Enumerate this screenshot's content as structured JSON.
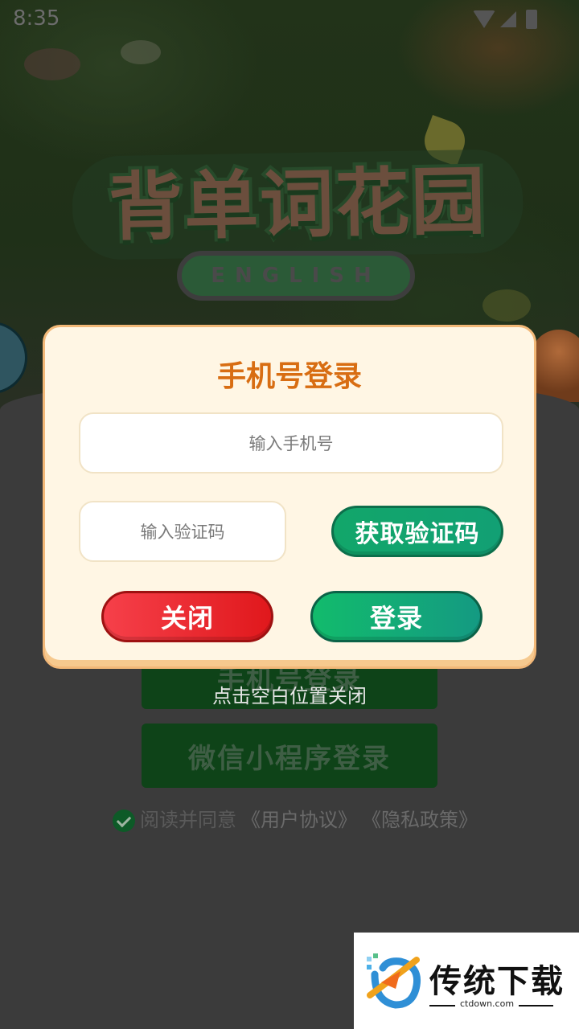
{
  "status_bar": {
    "time": "8:35"
  },
  "app_logo": {
    "title": "背单词花园",
    "subtitle": "ENGLISH"
  },
  "background_page": {
    "phone_login_label": "手机号登录",
    "wechat_login_label": "微信小程序登录",
    "agreement_prefix": "阅读并同意",
    "user_agreement": "《用户协议》",
    "privacy_policy": "《隐私政策》"
  },
  "dialog": {
    "title": "手机号登录",
    "phone_placeholder": "输入手机号",
    "code_placeholder": "输入验证码",
    "get_code_label": "获取验证码",
    "close_label": "关闭",
    "login_label": "登录"
  },
  "tap_hint": "点击空白位置关闭",
  "watermark": {
    "name": "传统下载",
    "domain": "ctdown.com"
  },
  "colors": {
    "dialog_title": "#d86d12",
    "dialog_bg": "#fff6e4",
    "close_button": "#e0181c",
    "login_button": "#12a66a"
  }
}
